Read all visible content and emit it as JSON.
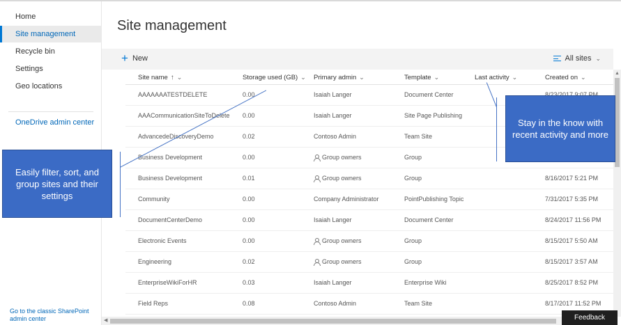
{
  "nav": {
    "items": [
      {
        "label": "Home",
        "active": false
      },
      {
        "label": "Site management",
        "active": true
      },
      {
        "label": "Recycle bin",
        "active": false
      },
      {
        "label": "Settings",
        "active": false
      },
      {
        "label": "Geo locations",
        "active": false
      }
    ],
    "onedrive_link": "OneDrive admin center",
    "classic_link": "Go to the classic SharePoint admin center"
  },
  "page": {
    "title": "Site management"
  },
  "commandbar": {
    "new_label": "New",
    "view_label": "All sites"
  },
  "table": {
    "columns": {
      "name": "Site name",
      "storage": "Storage used (GB)",
      "admin": "Primary admin",
      "template": "Template",
      "activity": "Last activity",
      "created": "Created on"
    },
    "rows": [
      {
        "name": "AAAAAAATESTDELETE",
        "storage": "0.00",
        "admin": "Isaiah Langer",
        "group": false,
        "template": "Document Center",
        "created": "8/23/2017 9:07 PM"
      },
      {
        "name": "AAACommunicationSiteToDelete",
        "storage": "0.00",
        "admin": "Isaiah Langer",
        "group": false,
        "template": "Site Page Publishing",
        "created": ""
      },
      {
        "name": "AdvancedeDiscoveryDemo",
        "storage": "0.02",
        "admin": "Contoso Admin",
        "group": false,
        "template": "Team Site",
        "created": ""
      },
      {
        "name": "Business Development",
        "storage": "0.00",
        "admin": "Group owners",
        "group": true,
        "template": "Group",
        "created": ""
      },
      {
        "name": "Business Development",
        "storage": "0.01",
        "admin": "Group owners",
        "group": true,
        "template": "Group",
        "created": "8/16/2017 5:21 PM"
      },
      {
        "name": "Community",
        "storage": "0.00",
        "admin": "Company Administrator",
        "group": false,
        "template": "PointPublishing Topic",
        "created": "7/31/2017 5:35 PM"
      },
      {
        "name": "DocumentCenterDemo",
        "storage": "0.00",
        "admin": "Isaiah Langer",
        "group": false,
        "template": "Document Center",
        "created": "8/24/2017 11:56 PM"
      },
      {
        "name": "Electronic Events",
        "storage": "0.00",
        "admin": "Group owners",
        "group": true,
        "template": "Group",
        "created": "8/15/2017 5:50 AM"
      },
      {
        "name": "Engineering",
        "storage": "0.02",
        "admin": "Group owners",
        "group": true,
        "template": "Group",
        "created": "8/15/2017 3:57 AM"
      },
      {
        "name": "EnterpriseWikiForHR",
        "storage": "0.03",
        "admin": "Isaiah Langer",
        "group": false,
        "template": "Enterprise Wiki",
        "created": "8/25/2017 8:52 PM"
      },
      {
        "name": "Field Reps",
        "storage": "0.08",
        "admin": "Contoso Admin",
        "group": false,
        "template": "Team Site",
        "created": "8/17/2017 11:52 PM"
      }
    ]
  },
  "callouts": {
    "left": "Easily filter, sort, and group sites and their settings",
    "right": "Stay in the know with recent activity and more"
  },
  "feedback_label": "Feedback",
  "colors": {
    "accent": "#0078d4",
    "callout": "#3b6bc5",
    "feedback_bg": "#1f1f1f"
  }
}
